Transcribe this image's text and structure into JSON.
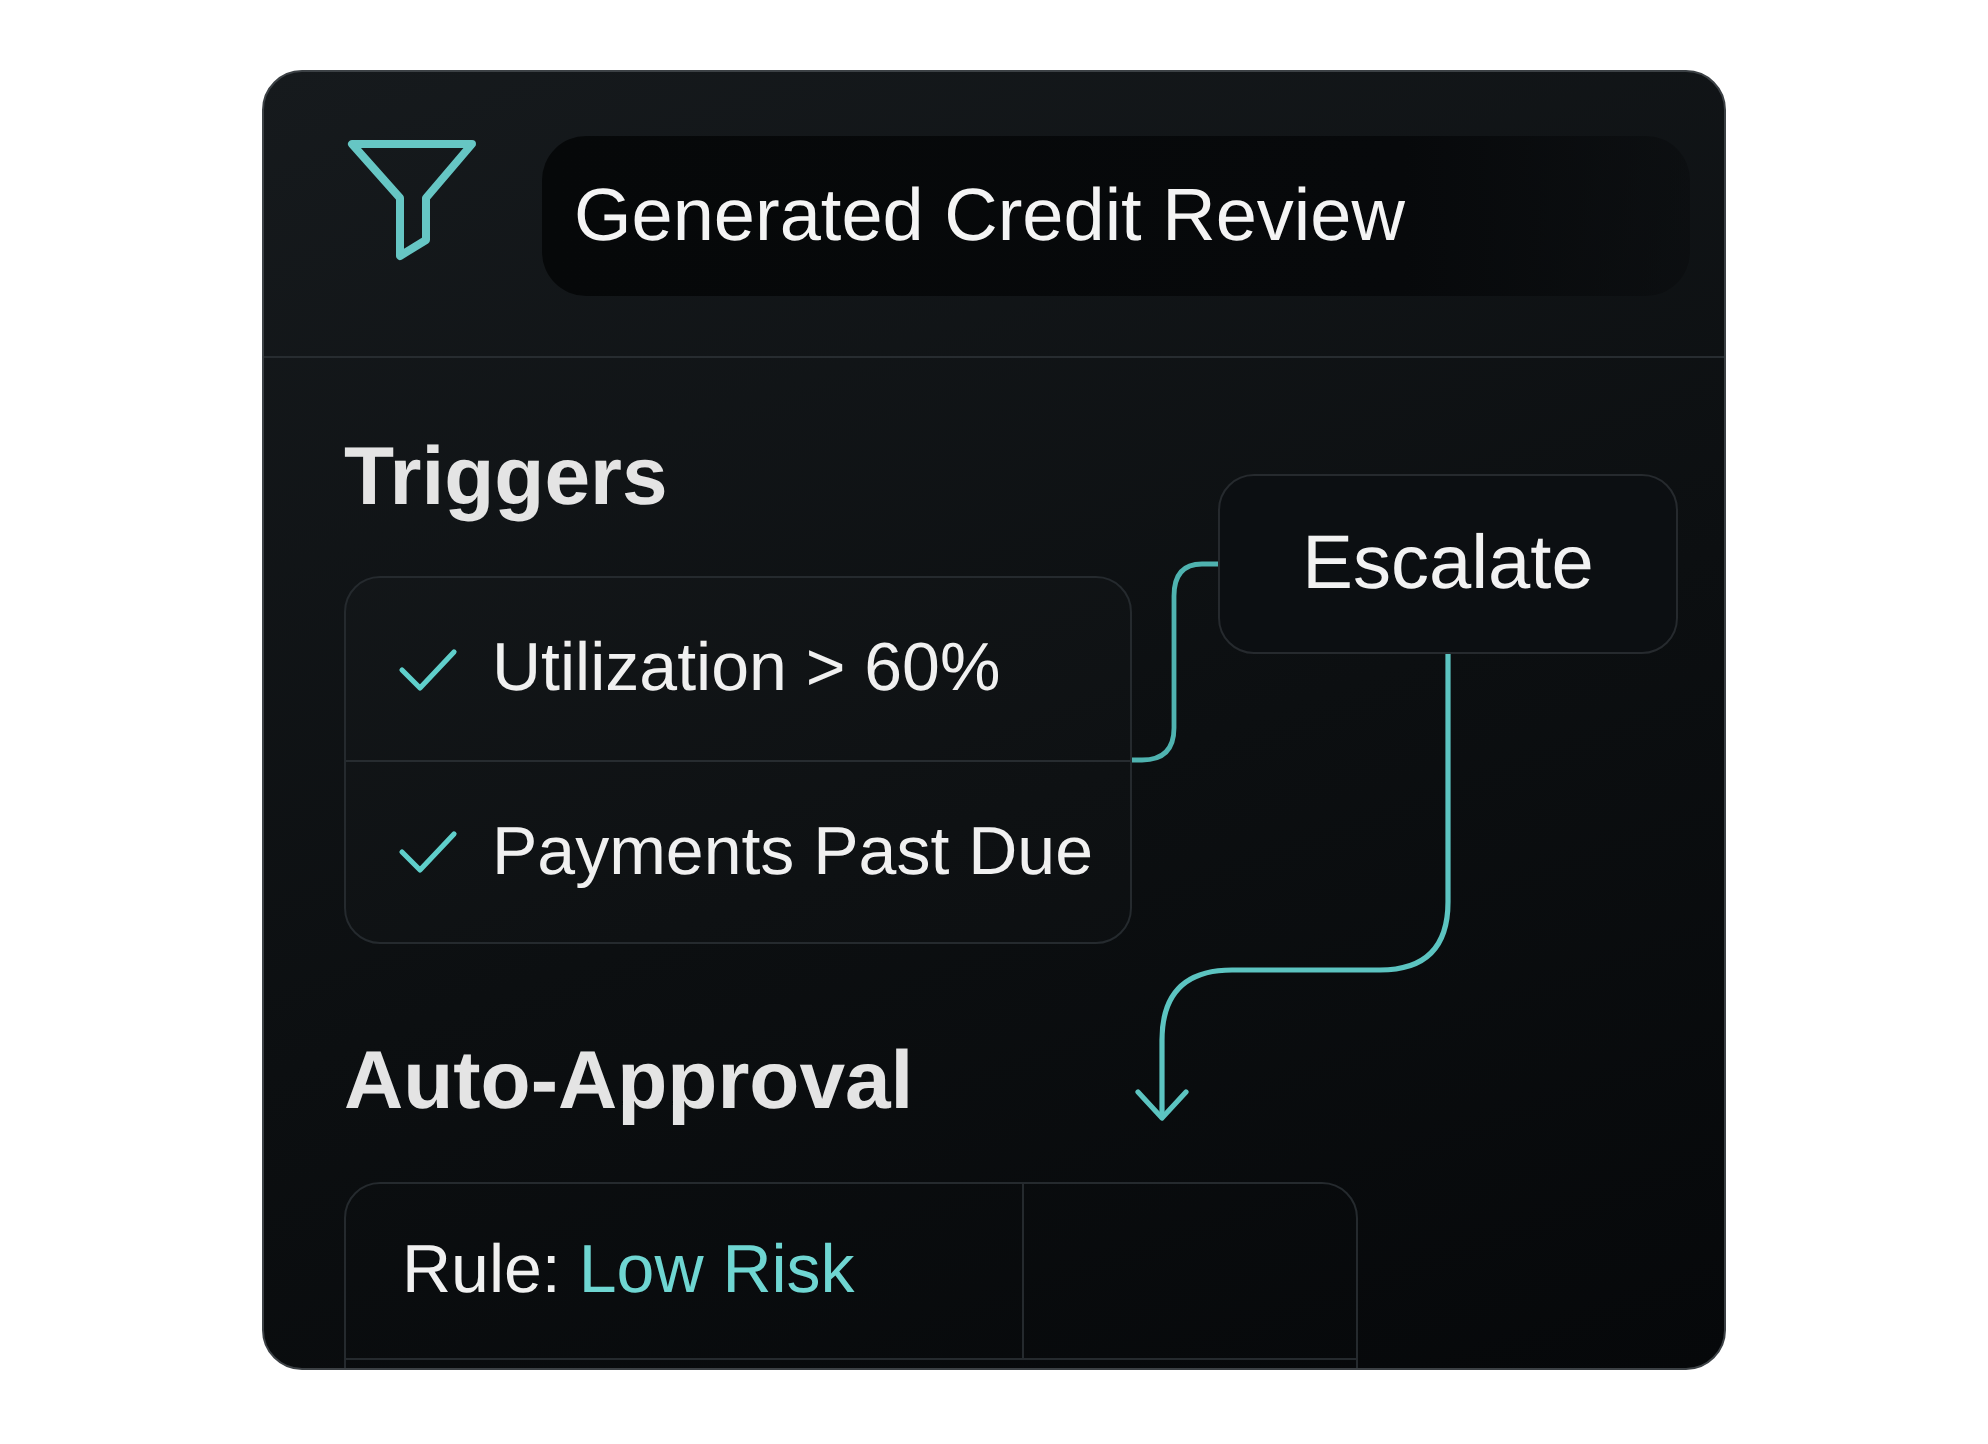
{
  "header": {
    "title": "Generated Credit Review"
  },
  "triggers": {
    "heading": "Triggers",
    "items": [
      {
        "label": "Utilization > 60%",
        "checked": true
      },
      {
        "label": "Payments Past Due",
        "checked": true
      }
    ]
  },
  "escalation": {
    "label": "Escalate"
  },
  "auto_approval": {
    "heading": "Auto-Approval",
    "rule": {
      "label": "Rule:",
      "value": "Low Risk"
    }
  }
}
